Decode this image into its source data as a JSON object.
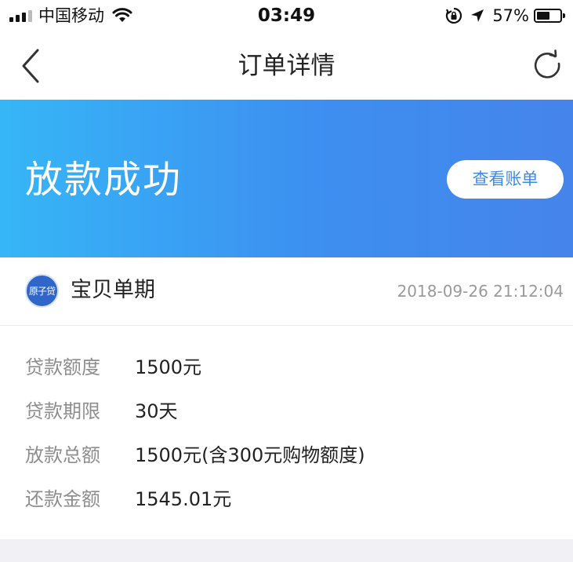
{
  "status_bar": {
    "carrier": "中国移动",
    "time": "03:49",
    "battery_percent_text": "57%",
    "battery_level": 0.57
  },
  "nav": {
    "title": "订单详情"
  },
  "banner": {
    "title": "放款成功",
    "view_bill_label": "查看账单",
    "gradient_start": "#36b6f7",
    "gradient_end": "#4584eb"
  },
  "product": {
    "logo_text": "原子贷",
    "name": "宝贝单期",
    "time": "2018-09-26 21:12:04"
  },
  "details": [
    {
      "label": "贷款额度",
      "value": "1500元"
    },
    {
      "label": "贷款期限",
      "value": "30天"
    },
    {
      "label": "放款总额",
      "value": "1500元(含300元购物额度)"
    },
    {
      "label": "还款金额",
      "value": "1545.01元"
    }
  ],
  "colors": {
    "accent": "#3f8ae8",
    "label_gray": "#8e8e8e",
    "time_gray": "#9a9a9a"
  }
}
